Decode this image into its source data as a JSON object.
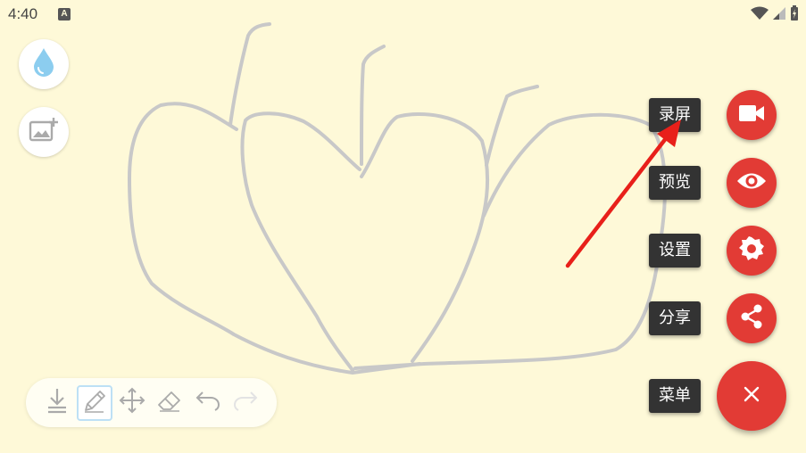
{
  "status_bar": {
    "time": "4:40",
    "notification_letter": "A"
  },
  "left_tools": {
    "ink_icon": "water-drop-icon",
    "image_icon": "add-photo-icon"
  },
  "toolbar": {
    "items": [
      {
        "icon": "save-download-icon",
        "enabled": true
      },
      {
        "icon": "pencil-icon",
        "enabled": true,
        "selected": true
      },
      {
        "icon": "move-icon",
        "enabled": true
      },
      {
        "icon": "eraser-icon",
        "enabled": true
      },
      {
        "icon": "undo-icon",
        "enabled": true
      },
      {
        "icon": "redo-icon",
        "enabled": false
      }
    ]
  },
  "fab_menu": {
    "items": [
      {
        "label": "录屏",
        "icon": "videocam-icon"
      },
      {
        "label": "预览",
        "icon": "eye-icon"
      },
      {
        "label": "设置",
        "icon": "gear-icon"
      },
      {
        "label": "分享",
        "icon": "share-icon"
      },
      {
        "label": "菜单",
        "icon": "close-icon"
      }
    ]
  },
  "colors": {
    "background": "#fef9d8",
    "accent": "#e23b35",
    "stroke": "#c8c8c8",
    "annotation_arrow": "#e8201a"
  }
}
